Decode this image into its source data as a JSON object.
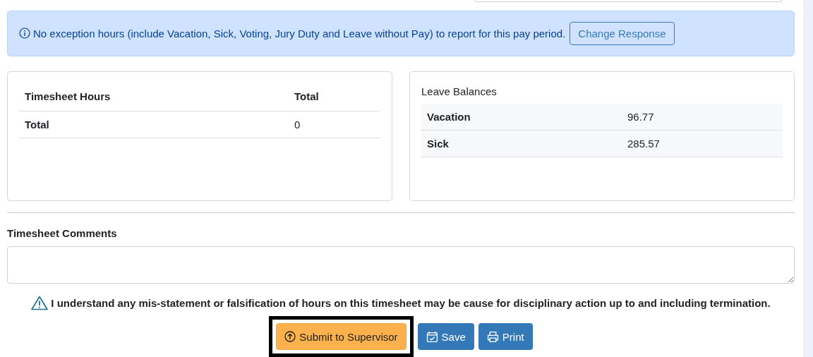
{
  "alert": {
    "message": "No exception hours (include Vacation, Sick, Voting, Jury Duty and Leave without Pay) to report for this pay period.",
    "button": "Change Response"
  },
  "hours": {
    "columns": [
      "Timesheet Hours",
      "Total"
    ],
    "rows": [
      [
        "Total",
        "0"
      ]
    ]
  },
  "leave": {
    "title": "Leave Balances",
    "rows": [
      [
        "Vacation",
        "96.77"
      ],
      [
        "Sick",
        "285.57"
      ]
    ]
  },
  "comments": {
    "label": "Timesheet Comments"
  },
  "warning": "I understand any mis-statement or falsification of hours on this timesheet may be cause for disciplinary action up to and including termination.",
  "buttons": [
    {
      "kind": "submit",
      "label": "Submit to Supervisor",
      "highlighted": true
    },
    {
      "kind": "save",
      "label": "Save",
      "highlighted": false
    },
    {
      "kind": "print",
      "label": "Print",
      "highlighted": false
    }
  ]
}
